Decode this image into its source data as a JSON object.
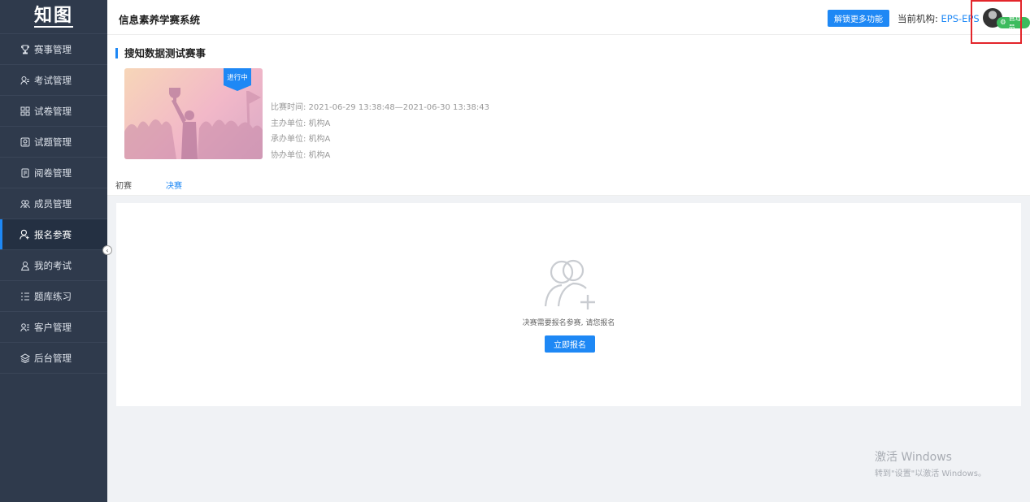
{
  "sidebar": {
    "logo": "知图",
    "items": [
      {
        "label": "赛事管理",
        "icon": "trophy-icon"
      },
      {
        "label": "考试管理",
        "icon": "exam-icon"
      },
      {
        "label": "试卷管理",
        "icon": "grid-icon"
      },
      {
        "label": "试题管理",
        "icon": "question-icon"
      },
      {
        "label": "阅卷管理",
        "icon": "document-icon"
      },
      {
        "label": "成员管理",
        "icon": "users-icon"
      },
      {
        "label": "报名参赛",
        "icon": "register-icon"
      },
      {
        "label": "我的考试",
        "icon": "person-icon"
      },
      {
        "label": "题库练习",
        "icon": "list-icon"
      },
      {
        "label": "客户管理",
        "icon": "customer-icon"
      },
      {
        "label": "后台管理",
        "icon": "layers-icon"
      }
    ],
    "active_index": 6
  },
  "header": {
    "title": "信息素养学赛系统",
    "unlock_label": "解锁更多功能",
    "org_prefix": "当前机构: ",
    "org_value": "EPS-EPS",
    "role_badge": "管理员"
  },
  "contest": {
    "title": "搜知数据测试赛事",
    "status": "进行中",
    "time": "比赛时间: 2021-06-29 13:38:48—2021-06-30 13:38:43",
    "host": "主办单位: 机构A",
    "organizer": "承办单位: 机构A",
    "co_organizer": "协办单位: 机构A"
  },
  "tabs": [
    {
      "label": "初赛",
      "active": false
    },
    {
      "label": "决赛",
      "active": true
    }
  ],
  "empty_state": {
    "message": "决赛需要报名参赛, 请您报名",
    "button_label": "立即报名"
  },
  "watermark": {
    "title": "激活 Windows",
    "subtitle": "转到\"设置\"以激活 Windows。"
  },
  "colors": {
    "accent": "#1e88f5",
    "sidebar_bg": "#2f3a4c",
    "badge_green": "#3dbb5e",
    "highlight_red": "#e3252b"
  }
}
